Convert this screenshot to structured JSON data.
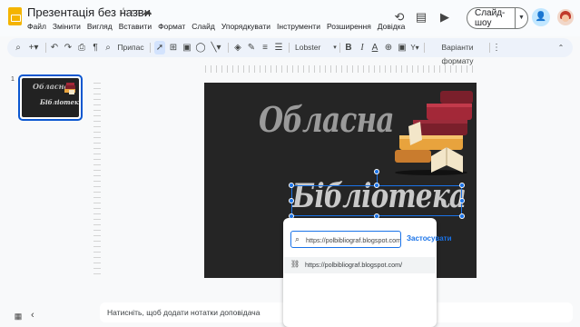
{
  "app": {
    "title": "Презентація без назви"
  },
  "menu": [
    "Файл",
    "Змінити",
    "Вигляд",
    "Вставити",
    "Формат",
    "Слайд",
    "Упорядкувати",
    "Інструменти",
    "Розширення",
    "Довідка"
  ],
  "header": {
    "slideshow_label": "Слайд-шоу"
  },
  "toolbar": {
    "fit_label": "Припас",
    "font": "Lobster",
    "format_options": "Варіанти формату"
  },
  "filmstrip": {
    "slide_number": "1",
    "thumb_title": "Обласна",
    "thumb_subtitle": "Бібліотека"
  },
  "slide": {
    "title": "Обласна",
    "subtitle": "Бібліотека"
  },
  "notes": {
    "placeholder": "Натисніть, щоб додати нотатки доповідача"
  },
  "link_popup": {
    "input_value": "https://polbibliograf.blogspot.com/",
    "apply_label": "Застосувати",
    "suggestion": "https://polbibliograf.blogspot.com/"
  },
  "colors": {
    "accent": "#1a73e8",
    "slide_bg": "#252525",
    "logo": "#f4b400",
    "share_bg": "#c2e7ff"
  }
}
